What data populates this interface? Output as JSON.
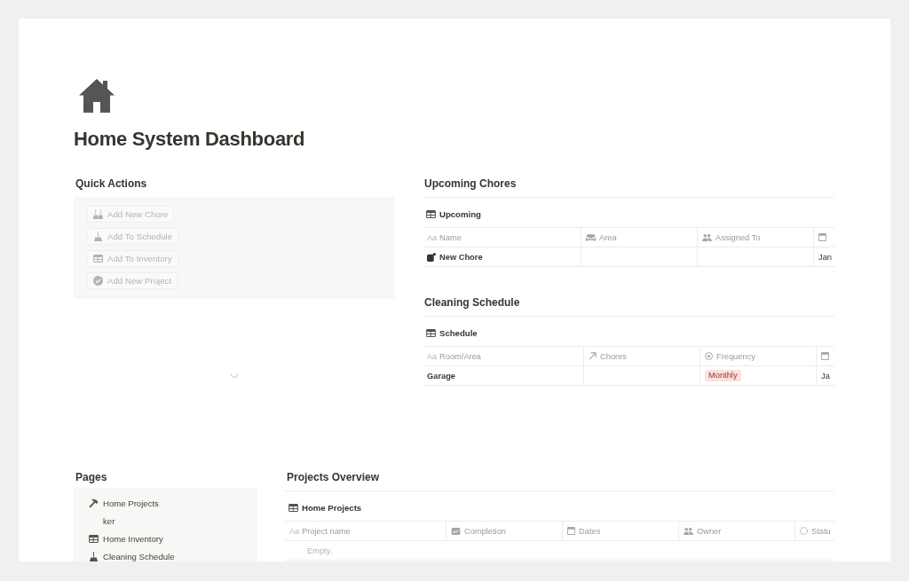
{
  "page": {
    "title": "Home System Dashboard"
  },
  "quick_actions": {
    "heading": "Quick Actions",
    "loading": true,
    "buttons": [
      {
        "label": "Add New Chore",
        "disabled": true
      },
      {
        "label": "Add To Schedule",
        "disabled": true
      },
      {
        "label": "Add To Inventory",
        "disabled": true
      },
      {
        "label": "Add New Project",
        "disabled": true
      }
    ]
  },
  "upcoming_chores": {
    "heading": "Upcoming Chores",
    "view": "Upcoming",
    "columns": [
      {
        "kind": "title",
        "glyph": "Aa",
        "label": "Name"
      },
      {
        "kind": "multi_select",
        "label": "Area"
      },
      {
        "kind": "person",
        "label": "Assigned To"
      },
      {
        "kind": "date"
      }
    ],
    "rows": [
      {
        "icon": true,
        "cells": [
          "New Chore",
          null,
          null,
          "Jan"
        ]
      }
    ]
  },
  "cleaning_schedule": {
    "heading": "Cleaning Schedule",
    "view": "Schedule",
    "columns": [
      {
        "kind": "title",
        "glyph": "Aa",
        "label": "Room/Area"
      },
      {
        "kind": "relation",
        "label": "Chores"
      },
      {
        "kind": "select",
        "label": "Frequency"
      },
      {
        "kind": "date"
      }
    ],
    "rows": [
      {
        "icon": false,
        "cells": [
          "Garage",
          null,
          {
            "label": "Monthly",
            "color": "#fbe2de"
          },
          "Ja"
        ]
      }
    ]
  },
  "pages": {
    "heading": "Pages",
    "items": [
      {
        "label": "Home Projects"
      },
      {
        "label": "ker"
      },
      {
        "label": "Home Inventory"
      },
      {
        "label": "Cleaning Schedule"
      }
    ]
  },
  "projects_overview": {
    "heading": "Projects Overview",
    "view": "Home Projects",
    "columns": [
      {
        "kind": "title",
        "glyph": "Aa",
        "label": "Project name"
      },
      {
        "kind": "rollup",
        "label": "Completion"
      },
      {
        "kind": "date",
        "label": "Dates"
      },
      {
        "kind": "person",
        "label": "Owner"
      },
      {
        "kind": "status",
        "label": "Statu"
      }
    ],
    "empty_text": "Empty."
  }
}
